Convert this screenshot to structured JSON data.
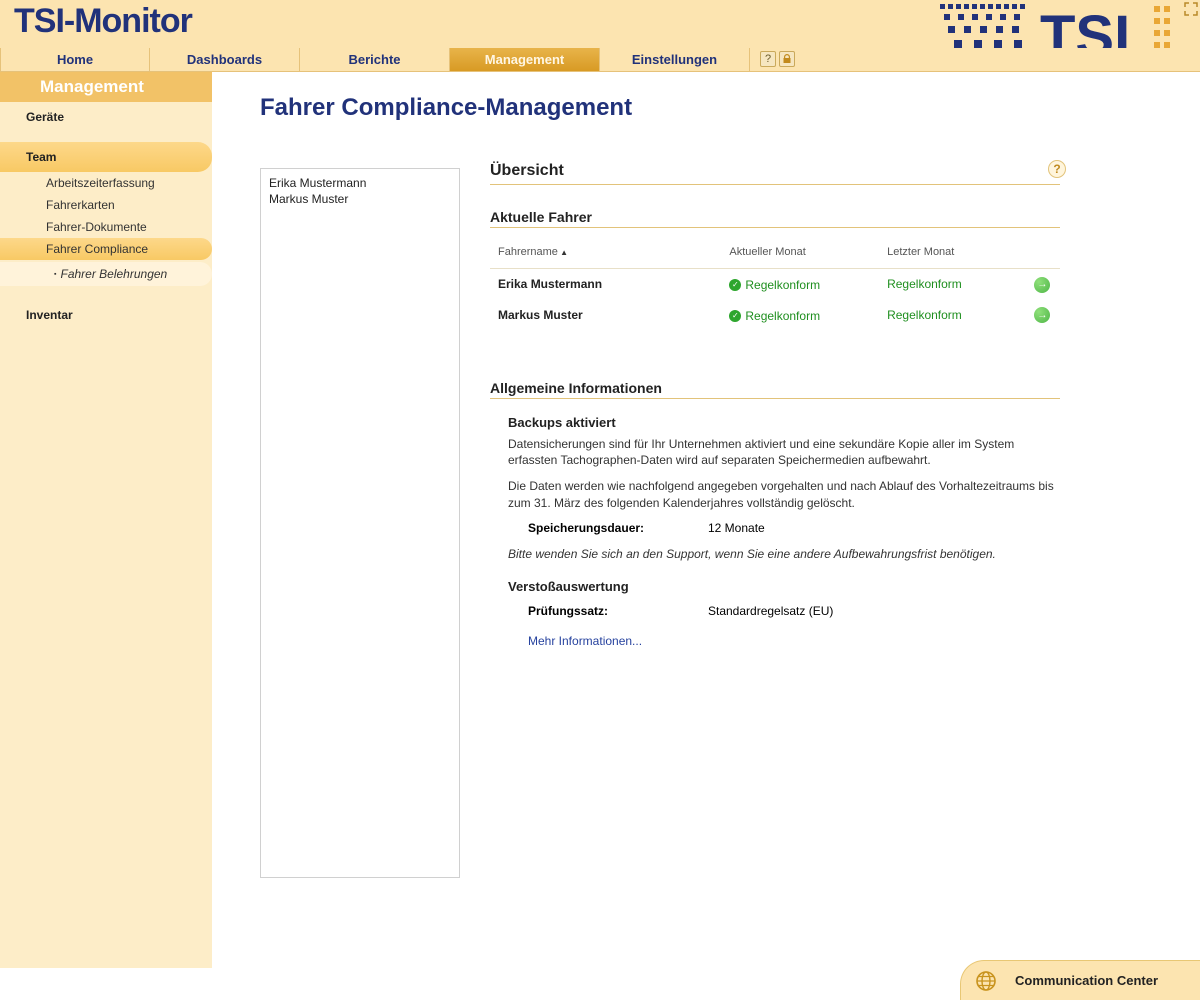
{
  "app_title": "TSI-Monitor",
  "nav": {
    "items": [
      "Home",
      "Dashboards",
      "Berichte",
      "Management",
      "Einstellungen"
    ],
    "active_index": 3
  },
  "sidebar": {
    "title": "Management",
    "section_devices": "Geräte",
    "section_team": "Team",
    "team_items": [
      "Arbeitszeiterfassung",
      "Fahrerkarten",
      "Fahrer-Dokumente",
      "Fahrer Compliance"
    ],
    "team_active_index": 3,
    "team_sub_item": "Fahrer Belehrungen",
    "section_inventory": "Inventar"
  },
  "page": {
    "title": "Fahrer Compliance-Management",
    "drivers_list": [
      "Erika Mustermann",
      "Markus Muster"
    ],
    "overview_heading": "Übersicht",
    "current_drivers_heading": "Aktuelle Fahrer",
    "table": {
      "col_name": "Fahrername",
      "col_current": "Aktueller Monat",
      "col_last": "Letzter Monat",
      "rows": [
        {
          "name": "Erika Mustermann",
          "current": "Regelkonform",
          "last": "Regelkonform"
        },
        {
          "name": "Markus Muster",
          "current": "Regelkonform",
          "last": "Regelkonform"
        }
      ]
    },
    "general_heading": "Allgemeine Informationen",
    "backups": {
      "heading": "Backups aktiviert",
      "p1": "Datensicherungen sind für Ihr Unternehmen aktiviert und eine sekundäre Kopie aller im System erfassten Tachographen-Daten wird auf separaten Speichermedien aufbewahrt.",
      "p2": "Die Daten werden wie nachfolgend angegeben vorgehalten und nach Ablauf des Vorhaltezeit­raums bis zum 31. März des folgenden Kalenderjahres vollständig gelöscht.",
      "retention_label": "Speicherungsdauer:",
      "retention_value": "12 Monate",
      "support_note": "Bitte wenden Sie sich an den Support, wenn Sie eine andere Aufbewahrungsfrist benötigen."
    },
    "violation": {
      "heading": "Verstoßauswertung",
      "ruleset_label": "Prüfungssatz:",
      "ruleset_value": "Standardregelsatz (EU)",
      "more_link": "Mehr Informationen..."
    }
  },
  "footer": {
    "label": "Communication Center"
  },
  "icons": {
    "help": "?",
    "lock": "lock-icon",
    "arrow": "→",
    "check": "✓",
    "sort_asc": "▲"
  }
}
